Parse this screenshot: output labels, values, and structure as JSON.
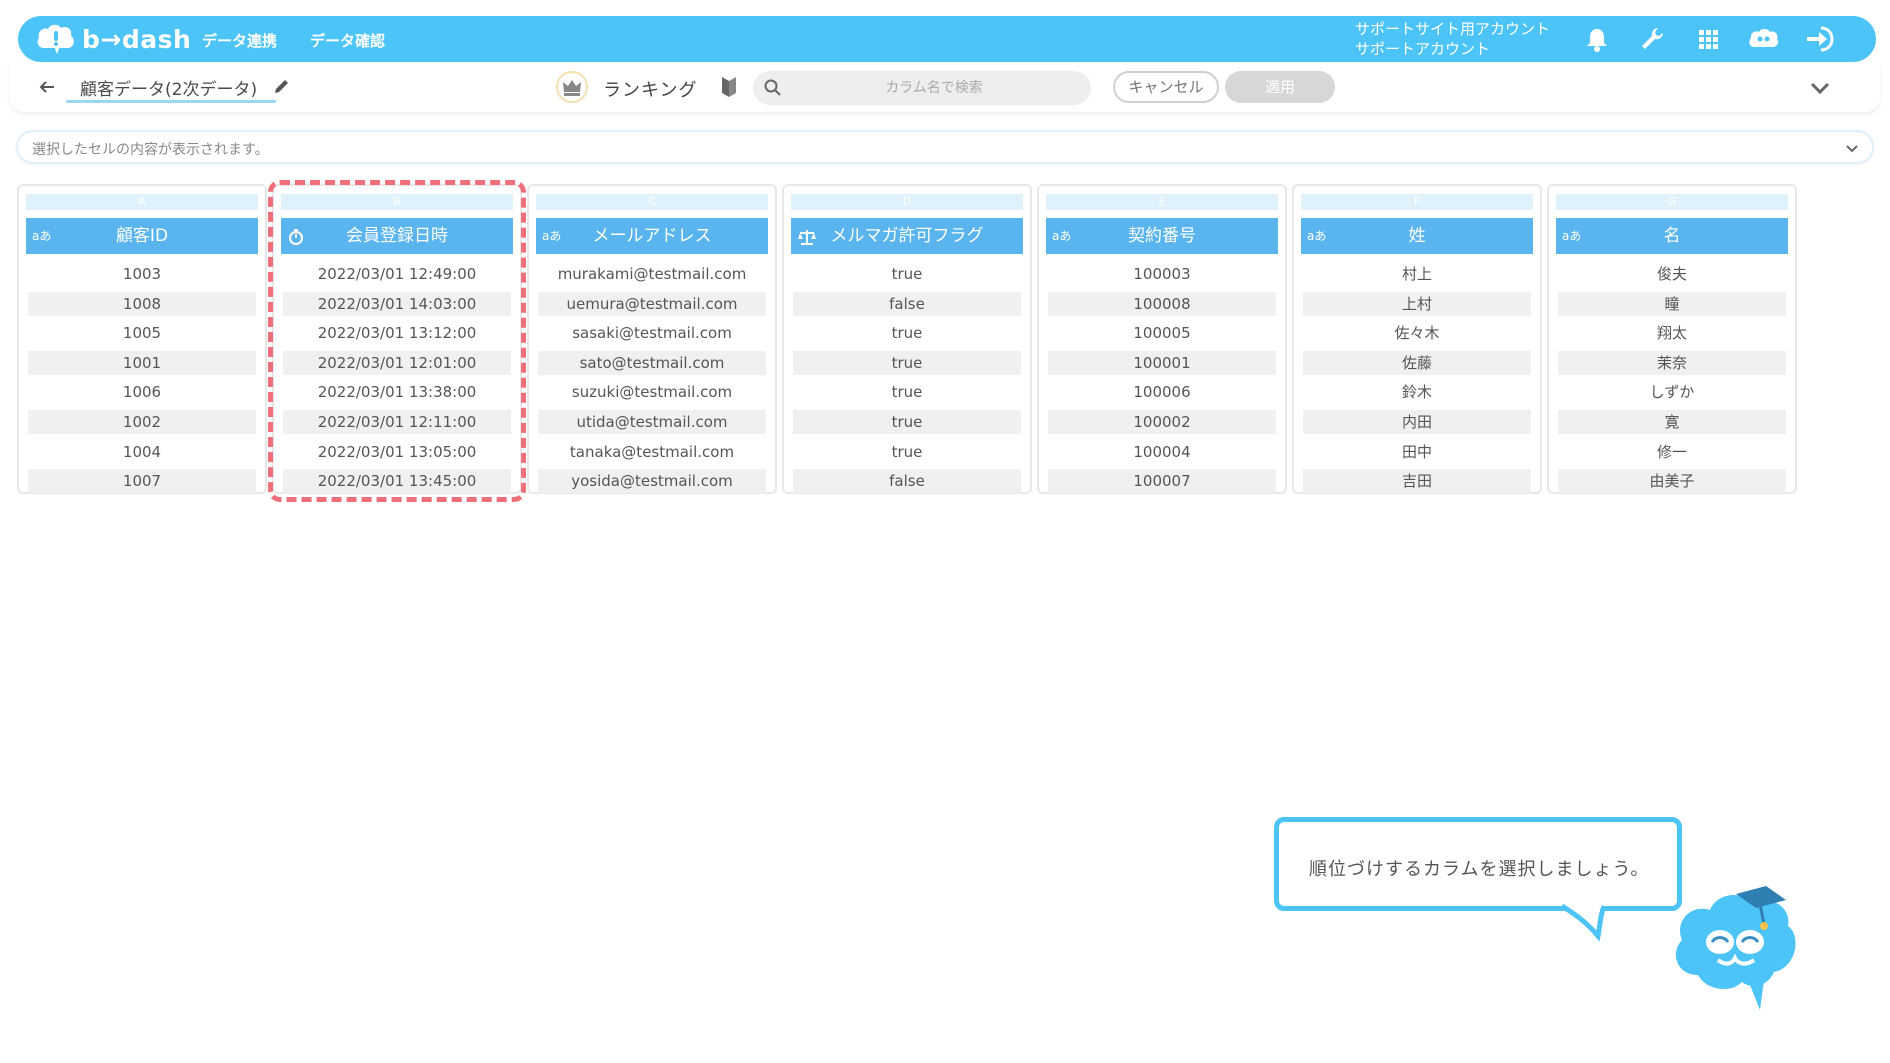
{
  "header": {
    "logo_text": "b→dash",
    "nav": [
      "データ連携",
      "データ確認"
    ],
    "account_line1": "サポートサイト用アカウント",
    "account_line2": "サポートアカウント"
  },
  "toolbar": {
    "title": "顧客データ(2次データ)",
    "mode_label": "ランキング",
    "search_placeholder": "カラム名で検索",
    "cancel_label": "キャンセル",
    "apply_label": "適用"
  },
  "cellbar": {
    "placeholder": "選択したセルの内容が表示されます。"
  },
  "columns": [
    {
      "letter": "A",
      "name": "顧客ID",
      "type": "text",
      "values": [
        "1003",
        "1008",
        "1005",
        "1001",
        "1006",
        "1002",
        "1004",
        "1007"
      ]
    },
    {
      "letter": "B",
      "name": "会員登録日時",
      "type": "datetime",
      "values": [
        "2022/03/01 12:49:00",
        "2022/03/01 14:03:00",
        "2022/03/01 13:12:00",
        "2022/03/01 12:01:00",
        "2022/03/01 13:38:00",
        "2022/03/01 12:11:00",
        "2022/03/01 13:05:00",
        "2022/03/01 13:45:00"
      ]
    },
    {
      "letter": "C",
      "name": "メールアドレス",
      "type": "text",
      "values": [
        "murakami@testmail.com",
        "uemura@testmail.com",
        "sasaki@testmail.com",
        "sato@testmail.com",
        "suzuki@testmail.com",
        "utida@testmail.com",
        "tanaka@testmail.com",
        "yosida@testmail.com"
      ]
    },
    {
      "letter": "D",
      "name": "メルマガ許可フラグ",
      "type": "boolean",
      "values": [
        "true",
        "false",
        "true",
        "true",
        "true",
        "true",
        "true",
        "false"
      ]
    },
    {
      "letter": "E",
      "name": "契約番号",
      "type": "text",
      "values": [
        "100003",
        "100008",
        "100005",
        "100001",
        "100006",
        "100002",
        "100004",
        "100007"
      ]
    },
    {
      "letter": "F",
      "name": "姓",
      "type": "text",
      "values": [
        "村上",
        "上村",
        "佐々木",
        "佐藤",
        "鈴木",
        "内田",
        "田中",
        "吉田"
      ]
    },
    {
      "letter": "G",
      "name": "名",
      "type": "text",
      "values": [
        "俊夫",
        "瞳",
        "翔太",
        "茉奈",
        "しずか",
        "寛",
        "修一",
        "由美子"
      ]
    }
  ],
  "type_text_label": "aあ",
  "tooltip": {
    "text": "順位づけするカラムを選択しましょう。"
  },
  "colors": {
    "brand": "#4dc4f7",
    "header_cell": "#5ab5ee",
    "highlight": "#ef6f7a"
  }
}
